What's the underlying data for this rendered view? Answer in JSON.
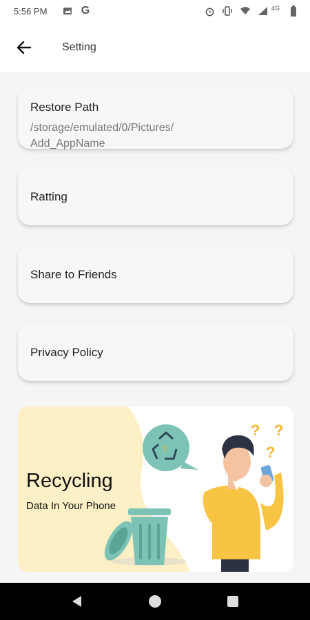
{
  "status_bar": {
    "time": "5:56 PM",
    "network": "4G",
    "icons": [
      "image-icon",
      "google-icon",
      "alarm-icon",
      "vibrate-icon",
      "wifi-icon",
      "signal-icon",
      "battery-icon"
    ]
  },
  "header": {
    "title": "Setting",
    "back_icon": "arrow-left-icon"
  },
  "settings": {
    "restore_path": {
      "label": "Restore Path",
      "path_line1": "/storage/emulated/0/Pictures/",
      "path_line2": "Add_AppName"
    },
    "rating": {
      "label": "Ratting"
    },
    "share": {
      "label": "Share to Friends"
    },
    "privacy": {
      "label": "Privacy Policy"
    }
  },
  "banner": {
    "headline": "Recycling",
    "tagline": "Data In Your Phone",
    "question_mark": "?"
  },
  "nav_bar": {
    "icons": [
      "back-triangle-icon",
      "home-circle-icon",
      "recents-square-icon"
    ]
  },
  "colors": {
    "banner_yellow": "#fdf0c6",
    "teal": "#7cc3b5",
    "shirt": "#f7c543",
    "question": "#f3b733"
  }
}
